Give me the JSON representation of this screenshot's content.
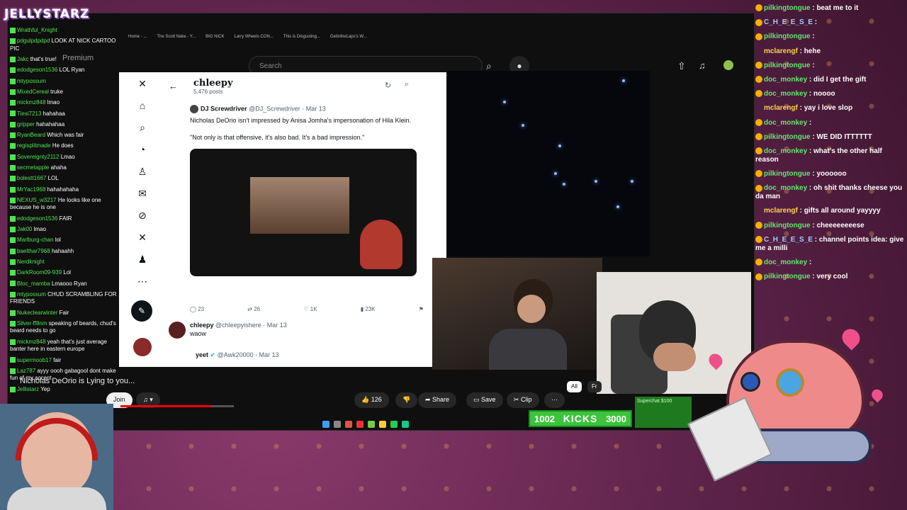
{
  "stream": {
    "logo_text": "JELLYSTARZ",
    "caption": "Nicholas DeOrio is Lying to you...",
    "kicks": {
      "current": "1002",
      "label": "KICKS",
      "goal": "3000"
    },
    "superchat_label": "Superchat $100",
    "kicks_fill_fraction": 0.33
  },
  "browser": {
    "tabs": [
      "Home - ...",
      "The Scott Nake - Y...",
      "BIG NICK",
      "Larry Wheels CON...",
      "This is Disgusting...",
      "GetintheLaps's W..."
    ],
    "premium_label": "Premium",
    "search_placeholder": "Search"
  },
  "twitter": {
    "profile_name": "chleepy",
    "post_count": "5,476 posts",
    "tweet1": {
      "author": "DJ Screwdriver",
      "handle": "@DJ_Screwdriver",
      "date": "Mar 13",
      "line1": "Nicholas DeOrio isn't impressed by Anisa Jomha's impersonation of Hila Klein.",
      "line2": "\"Not only is that offensive, it's also bad. It's a bad impression.\"",
      "replies": "23",
      "retweets": "26",
      "likes": "1K",
      "views": "23K"
    },
    "tweet2": {
      "author": "chleepy",
      "handle": "@chleepyishere",
      "date": "Mar 13",
      "body": "waow"
    },
    "tweet3": {
      "author": "yeet",
      "handle": "@Awk20000",
      "date": "Mar 13"
    }
  },
  "video_controls": {
    "join_label": "Join",
    "likes": "126",
    "share_label": "Share",
    "save_label": "Save",
    "clip_label": "Clip",
    "chips": [
      "All",
      "Fr"
    ]
  },
  "left_chat": [
    {
      "user": "Wrathful_Knight",
      "msg": ""
    },
    {
      "user": "pdgulpdpdpd",
      "msg": "LOOK AT NICK CARTOO PIC"
    },
    {
      "user": "Jakc",
      "msg": "that's true!"
    },
    {
      "user": "edodgeson1536",
      "msg": "LOL Ryan"
    },
    {
      "user": "mtypossum",
      "msg": ""
    },
    {
      "user": "MixedCereal",
      "msg": "truke"
    },
    {
      "user": "mickmz848",
      "msg": "lmao"
    },
    {
      "user": "Tiesi7213",
      "msg": "hahahaa"
    },
    {
      "user": "gripper",
      "msg": "hahahahaa"
    },
    {
      "user": "RyanBeard",
      "msg": "Which was fair"
    },
    {
      "user": "regisplitmade",
      "msg": "He does"
    },
    {
      "user": "Sovereignty2112",
      "msg": "Lmao"
    },
    {
      "user": "secmetapple",
      "msg": "ahaha"
    },
    {
      "user": "bolestt1667",
      "msg": "LOL"
    },
    {
      "user": "MrYac1968",
      "msg": "hahahahaha"
    },
    {
      "user": "NEXUS_w3217",
      "msg": "He looks like one because he is one"
    },
    {
      "user": "edodgeson1536",
      "msg": "FAIR"
    },
    {
      "user": "Jak00",
      "msg": "lmao"
    },
    {
      "user": "Marlburg-chan",
      "msg": "lol"
    },
    {
      "user": "baelthar7968",
      "msg": "hahaahh"
    },
    {
      "user": "Nerdknight",
      "msg": ""
    },
    {
      "user": "DarkRoom09-939",
      "msg": "Lol"
    },
    {
      "user": "Bloc_mamba",
      "msg": "Lmaooo Ryan"
    },
    {
      "user": "mtypossum",
      "msg": "CHUD SCRAMBLING FOR FRIENDS"
    },
    {
      "user": "Nukeclearwinter",
      "msg": "Fair"
    },
    {
      "user": "Silver-ff8nm",
      "msg": "speaking of beards, chud's beard needs to go"
    },
    {
      "user": "mickmz848",
      "msg": "yeah that's just average banter here in eastern europe"
    },
    {
      "user": "supermoob17",
      "msg": "fair"
    },
    {
      "user": "Laz787",
      "msg": "ayyy oooh gabagool dont make fun of my accent"
    },
    {
      "user": "Jellistarz",
      "msg": "Yep"
    }
  ],
  "right_chat": [
    {
      "user": "pilkingtongue",
      "msg": "beat me to it",
      "cls": "u-pilk"
    },
    {
      "user": "C_H_E_E_S_E",
      "msg": "",
      "cls": "u-chz"
    },
    {
      "user": "pilkingtongue",
      "msg": "",
      "cls": "u-pilk"
    },
    {
      "user": "mclarengf",
      "msg": "hehe",
      "cls": "u-mcl"
    },
    {
      "user": "pilkingtongue",
      "msg": "",
      "cls": "u-pilk"
    },
    {
      "user": "doc_monkey",
      "msg": "did I get the gift",
      "cls": "u-doc"
    },
    {
      "user": "doc_monkey",
      "msg": "noooo",
      "cls": "u-doc"
    },
    {
      "user": "mclarengf",
      "msg": "yay i love slop",
      "cls": "u-mcl"
    },
    {
      "user": "doc_monkey",
      "msg": "",
      "cls": "u-doc"
    },
    {
      "user": "pilkingtongue",
      "msg": "WE DID ITTTTTT",
      "cls": "u-pilk"
    },
    {
      "user": "doc_monkey",
      "msg": "what's the other half reason",
      "cls": "u-doc"
    },
    {
      "user": "pilkingtongue",
      "msg": "yoooooo",
      "cls": "u-pilk"
    },
    {
      "user": "doc_monkey",
      "msg": "oh shit thanks cheese you da man",
      "cls": "u-doc"
    },
    {
      "user": "mclarengf",
      "msg": "gifts all around yayyyy",
      "cls": "u-mcl"
    },
    {
      "user": "pilkingtongue",
      "msg": "cheeeeeeeese",
      "cls": "u-pilk"
    },
    {
      "user": "C_H_E_E_S_E",
      "msg": "channel points idea: give me a milli",
      "cls": "u-chz"
    },
    {
      "user": "doc_monkey",
      "msg": "",
      "cls": "u-doc"
    },
    {
      "user": "pilkingtongue",
      "msg": "very cool",
      "cls": "u-pilk"
    }
  ],
  "colors": {
    "chat_green": "#62e86f",
    "chat_yellow": "#ffd34e",
    "kick_green": "#3cc43c",
    "brand_red": "#ff0000"
  }
}
